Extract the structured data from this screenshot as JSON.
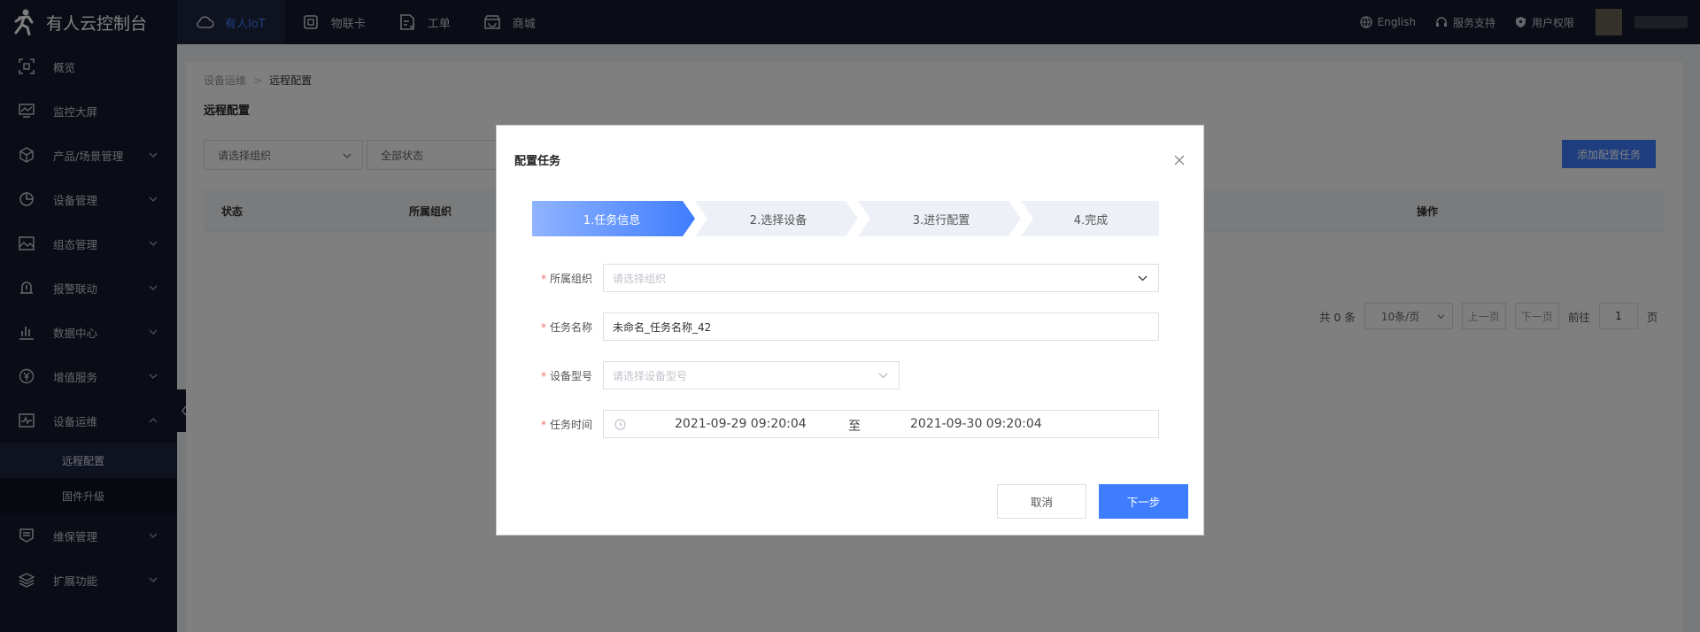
{
  "app": {
    "title": "有人云控制台",
    "logo_icon": "person-running-icon"
  },
  "topnav": [
    {
      "label": "有人IoT",
      "icon": "cloud-icon",
      "active": true
    },
    {
      "label": "物联卡",
      "icon": "sim-card-icon"
    },
    {
      "label": "工单",
      "icon": "work-order-icon"
    },
    {
      "label": "商城",
      "icon": "store-icon"
    }
  ],
  "topright": {
    "language": "English",
    "support": "服务支持",
    "permission": "用户权限"
  },
  "sidebar": {
    "items": [
      {
        "label": "概览",
        "icon": "overview-icon"
      },
      {
        "label": "监控大屏",
        "icon": "monitor-icon"
      },
      {
        "label": "产品/场景管理",
        "icon": "cube-icon"
      },
      {
        "label": "设备管理",
        "icon": "pie-icon"
      },
      {
        "label": "组态管理",
        "icon": "image-icon"
      },
      {
        "label": "报警联动",
        "icon": "alarm-icon"
      },
      {
        "label": "数据中心",
        "icon": "bar-chart-icon"
      },
      {
        "label": "增值服务",
        "icon": "yen-icon"
      },
      {
        "label": "设备运维",
        "icon": "pulse-icon"
      }
    ],
    "subitems": [
      {
        "label": "远程配置",
        "active": true
      },
      {
        "label": "固件升级"
      }
    ],
    "bottom": [
      {
        "label": "维保管理",
        "icon": "maintenance-icon"
      },
      {
        "label": "扩展功能",
        "icon": "layers-icon"
      }
    ]
  },
  "main": {
    "breadcrumb": [
      "设备运维",
      "远程配置"
    ],
    "title": "远程配置",
    "filter_org": "请选择组织",
    "filter_status": "全部状态",
    "add_button": "添加配置任务",
    "table": {
      "col_status": "状态",
      "col_org": "所属组织",
      "col_action": "操作"
    },
    "pager": {
      "total": "共 0 条",
      "size": "10条/页",
      "prev": "上一页",
      "next": "下一页",
      "goto": "前往",
      "page": "1",
      "page_suffix": "页"
    }
  },
  "modal": {
    "title": "配置任务",
    "steps": [
      "1.任务信息",
      "2.选择设备",
      "3.进行配置",
      "4.完成"
    ],
    "fields": {
      "org_label": "所属组织",
      "org_placeholder": "请选择组织",
      "name_label": "任务名称",
      "name_value": "未命名_任务名称_42",
      "model_label": "设备型号",
      "model_placeholder": "请选择设备型号",
      "time_label": "任务时间",
      "time_start": "2021-09-29 09:20:04",
      "time_sep": "至",
      "time_end": "2021-09-30 09:20:04"
    },
    "cancel": "取消",
    "next": "下一步"
  },
  "colors": {
    "primary": "#3f7dff",
    "nav_bg": "#141a2b",
    "required": "#f56c6c"
  }
}
